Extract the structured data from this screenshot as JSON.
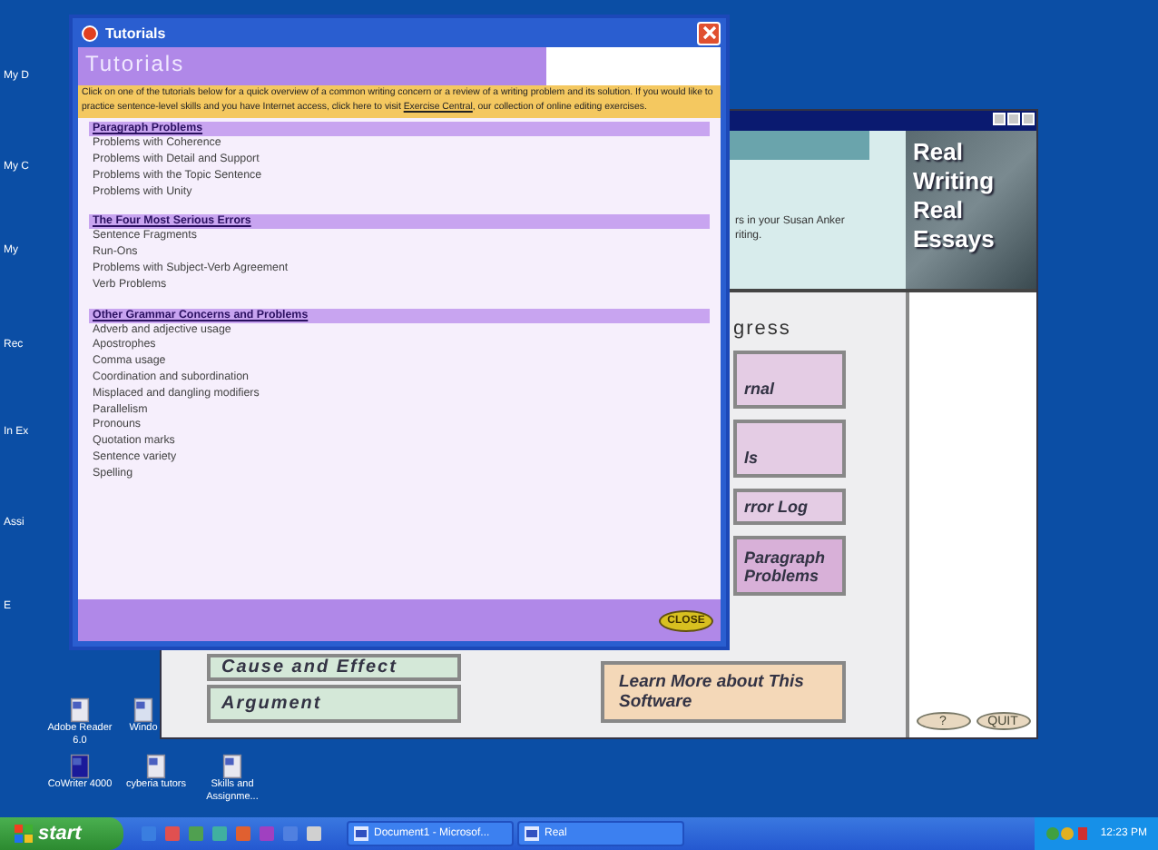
{
  "desktop_icons_left": [
    {
      "label": "My D"
    },
    {
      "label": "My C"
    },
    {
      "label": "My"
    },
    {
      "label": "Rec"
    },
    {
      "label": "In Ex"
    },
    {
      "label": "Assi"
    },
    {
      "label": "E"
    }
  ],
  "desktop_icons_bottom": [
    {
      "label": "Adobe Reader 6.0",
      "kind": "document"
    },
    {
      "label": "Windo",
      "kind": "media"
    },
    {
      "label": "CoWriter 4000",
      "kind": "program"
    },
    {
      "label": "cyberia tutors",
      "kind": "document"
    },
    {
      "label": "Skills and Assignme...",
      "kind": "document"
    }
  ],
  "app_window": {
    "header_text": [
      "rs in your Susan Anker",
      "riting."
    ],
    "logo_lines": [
      "Real",
      "Writing",
      "Real",
      "Essays"
    ],
    "progress_heading": "gress",
    "right_buttons": [
      {
        "label": "rnal"
      },
      {
        "label": "ls"
      },
      {
        "label": "rror Log"
      },
      {
        "label": "Paragraph Problems"
      }
    ],
    "left_buttons": [
      {
        "label": "Cause and Effect"
      },
      {
        "label": "Argument"
      }
    ],
    "info_button": "Learn More about This Software",
    "help_button": "?",
    "quit_button": "QUIT"
  },
  "tutorials_window": {
    "title": "Tutorials",
    "header": "Tutorials",
    "intro": "Click on one of the tutorials below for a quick overview of a common writing concern or a review of a writing problem and its solution. If you would like to practice sentence-level skills and you have Internet access, click here to visit",
    "intro_link": "Exercise Central",
    "intro_end": ", our collection of online editing exercises.",
    "sections": [
      {
        "heading": "Paragraph Problems",
        "items": [
          "Problems with Coherence",
          "Problems with Detail and Support",
          "Problems with the Topic Sentence",
          "Problems with Unity"
        ]
      },
      {
        "heading": "The Four Most Serious Errors",
        "items": [
          "Sentence Fragments",
          "Run-Ons",
          "Problems with Subject-Verb Agreement",
          "Verb Problems"
        ]
      },
      {
        "heading": "Other Grammar Concerns and Problems",
        "items": [
          "Adverb and adjective usage",
          "Apostrophes",
          "Comma usage",
          "Coordination and subordination",
          "Misplaced and dangling modifiers",
          "Parallelism",
          "Pronouns",
          "Quotation marks",
          "Sentence variety",
          "Spelling"
        ]
      }
    ],
    "close_button": "CLOSE"
  },
  "taskbar": {
    "start": "start",
    "tasks": [
      "Document1 - Microsof...",
      "Real"
    ],
    "clock": "12:23 PM"
  }
}
